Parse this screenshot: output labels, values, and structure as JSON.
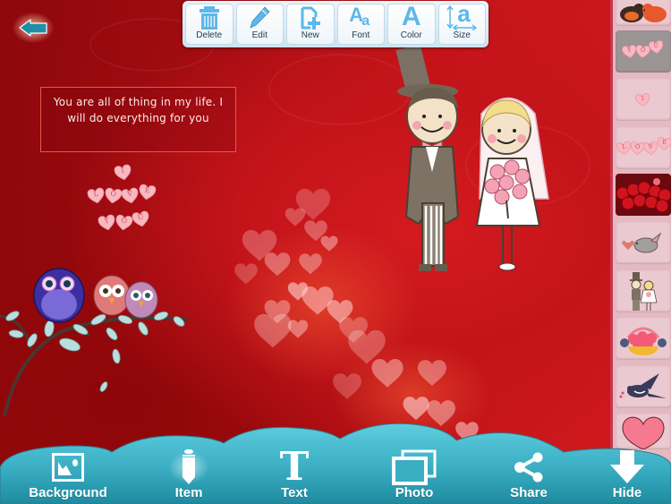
{
  "toolbar": {
    "items": [
      {
        "label": "Delete",
        "icon": "trash-icon"
      },
      {
        "label": "Edit",
        "icon": "pencil-icon"
      },
      {
        "label": "New",
        "icon": "new-document-icon"
      },
      {
        "label": "Font",
        "icon": "font-icon"
      },
      {
        "label": "Color",
        "icon": "color-letter-icon"
      },
      {
        "label": "Size",
        "icon": "text-size-icon"
      }
    ],
    "font_glyph_big": "A",
    "font_glyph_small": "a",
    "color_glyph": "A",
    "size_glyph": "a"
  },
  "back_button": {
    "icon": "back-arrow-icon"
  },
  "canvas": {
    "text_box": "You are all of thing in my life. I will do everything for you",
    "candy_rows": [
      [
        "I"
      ],
      [
        "L",
        "O",
        "V",
        "E"
      ],
      [
        "Y",
        "O",
        "U"
      ]
    ],
    "stickers": [
      "wedding-couple-sticker",
      "owls-on-branch-sticker",
      "bokeh-hearts-background"
    ]
  },
  "sidebar": {
    "items": [
      {
        "name": "birds-kissing",
        "selected": false
      },
      {
        "name": "candy-you",
        "selected": true,
        "letters": [
          "Y",
          "O",
          "U"
        ]
      },
      {
        "name": "candy-i",
        "selected": false,
        "letters": [
          "I"
        ]
      },
      {
        "name": "candy-love",
        "selected": false,
        "letters": [
          "L",
          "O",
          "V",
          "E"
        ]
      },
      {
        "name": "roses",
        "selected": false
      },
      {
        "name": "dove-heart",
        "selected": false
      },
      {
        "name": "wedding-couple",
        "selected": false
      },
      {
        "name": "flower-basket",
        "selected": false
      },
      {
        "name": "swallow-bird",
        "selected": false
      },
      {
        "name": "pink-heart",
        "selected": false
      }
    ]
  },
  "bottom_bar": {
    "items": [
      {
        "label": "Background",
        "icon": "image-icon"
      },
      {
        "label": "Item",
        "icon": "item-pencil-icon",
        "active": true
      },
      {
        "label": "Text",
        "icon": "text-T-icon",
        "glyph": "T"
      },
      {
        "label": "Photo",
        "icon": "photo-stack-icon"
      },
      {
        "label": "Share",
        "icon": "share-icon"
      },
      {
        "label": "Hide",
        "icon": "down-arrow-icon"
      }
    ]
  },
  "colors": {
    "canvas_red": "#c4141a",
    "toolbar_icon_blue": "#5cb8ea",
    "bottom_teal": "#3aaec3",
    "back_arrow_teal": "#1f8ea6",
    "sidebar_pink": "#ebc9d0"
  }
}
